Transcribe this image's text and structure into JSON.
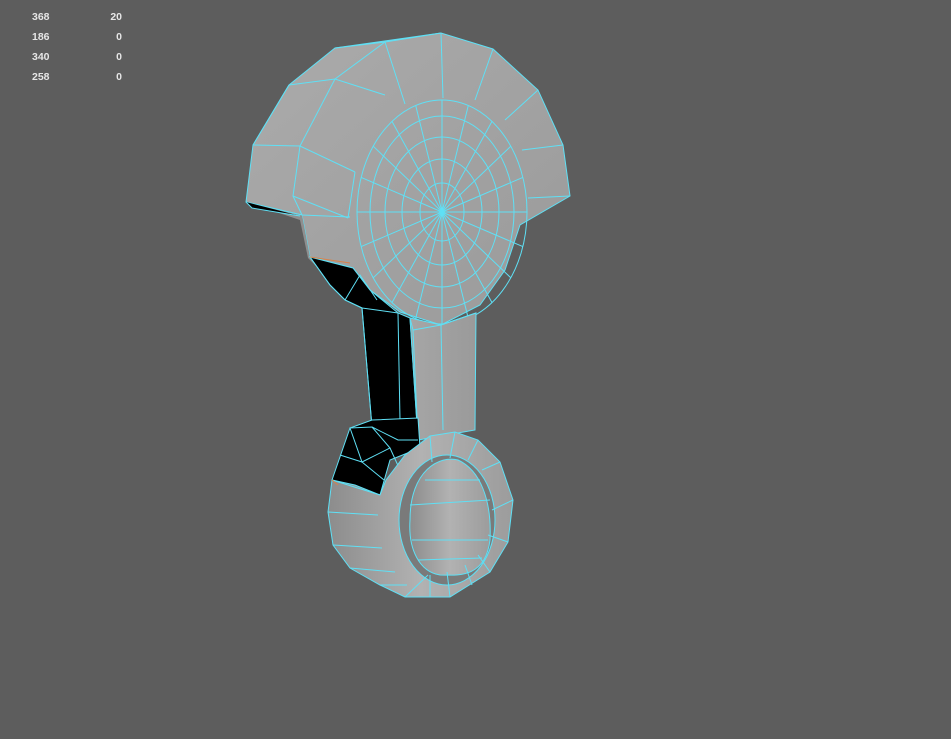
{
  "hud": {
    "rows": [
      {
        "a": "368",
        "b": "20"
      },
      {
        "a": "186",
        "b": "0"
      },
      {
        "a": "340",
        "b": "0"
      },
      {
        "a": "258",
        "b": "0"
      }
    ]
  },
  "colors": {
    "background": "#5d5d5d",
    "wireframe": "#5fe0f5",
    "surface": "#a3a3a3",
    "backface": "#000000"
  }
}
